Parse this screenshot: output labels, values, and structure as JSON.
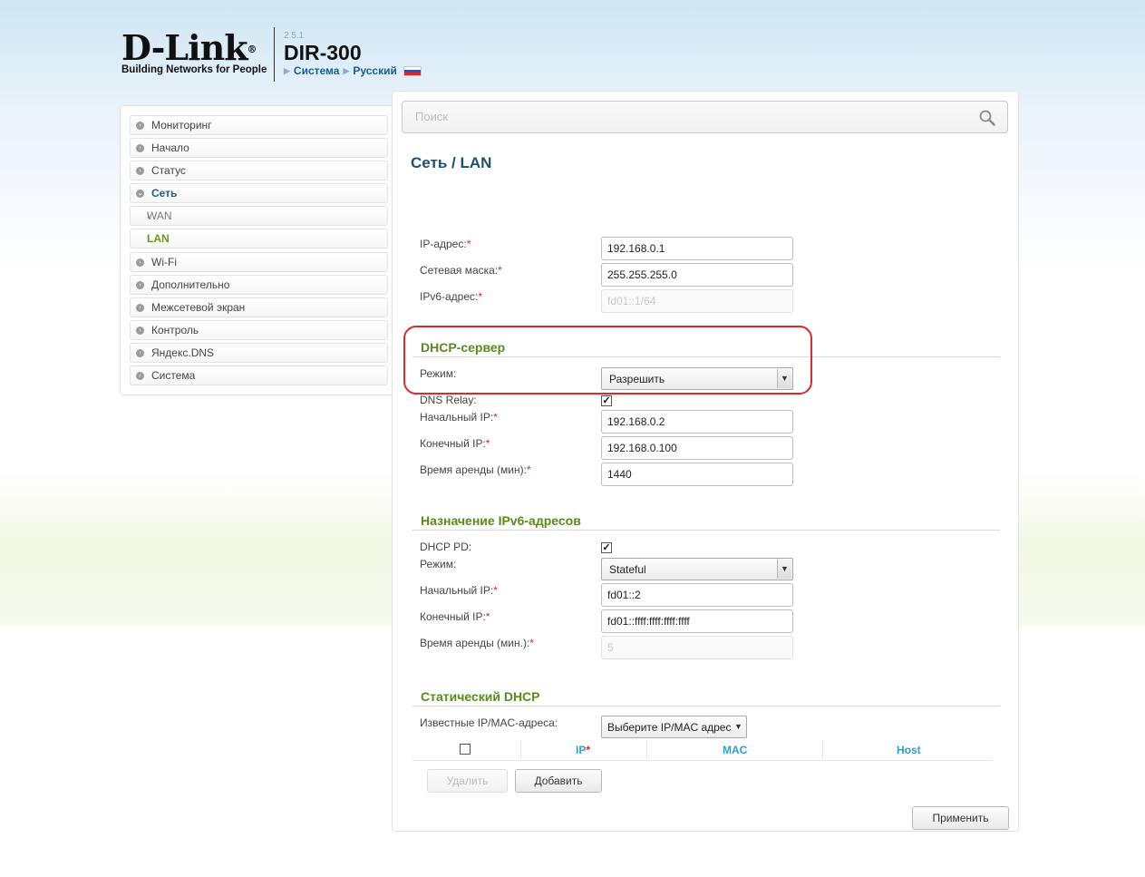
{
  "header": {
    "logo_main": "D-Link",
    "logo_reg": "®",
    "logo_sub": "Building Networks for People",
    "version": "2.5.1",
    "model": "DIR-300",
    "system_link": "Система",
    "language_link": "Русский"
  },
  "sidebar": {
    "items": [
      {
        "label": "Мониторинг"
      },
      {
        "label": "Начало"
      },
      {
        "label": "Статус"
      },
      {
        "label": "Сеть"
      },
      {
        "label": "WAN"
      },
      {
        "label": "LAN"
      },
      {
        "label": "Wi-Fi"
      },
      {
        "label": "Дополнительно"
      },
      {
        "label": "Межсетевой экран"
      },
      {
        "label": "Контроль"
      },
      {
        "label": "Яндекс.DNS"
      },
      {
        "label": "Система"
      }
    ]
  },
  "search": {
    "placeholder": "Поиск"
  },
  "page": {
    "title": "Сеть /  LAN"
  },
  "lan": {
    "ip_label": "IP-адрес:",
    "ip_value": "192.168.0.1",
    "mask_label": "Сетевая маска:",
    "mask_value": "255.255.255.0",
    "ipv6_label": "IPv6-адрес:",
    "ipv6_value": "fd01::1/64"
  },
  "dhcp": {
    "title": "DHCP-сервер",
    "mode_label": "Режим:",
    "mode_value": "Разрешить",
    "relay_label": "DNS Relay:",
    "relay_checked": true,
    "start_label": "Начальный IP:",
    "start_value": "192.168.0.2",
    "end_label": "Конечный IP:",
    "end_value": "192.168.0.100",
    "lease_label": "Время аренды (мин):",
    "lease_value": "1440"
  },
  "ipv6": {
    "title": "Назначение IPv6-адресов",
    "pd_label": "DHCP PD:",
    "pd_checked": true,
    "mode_label": "Режим:",
    "mode_value": "Stateful",
    "start_label": "Начальный IP:",
    "start_value": "fd01::2",
    "end_label": "Конечный IP:",
    "end_value": "fd01::ffff:ffff:ffff:ffff",
    "lease_label": "Время аренды (мин.):",
    "lease_value": "5"
  },
  "static_dhcp": {
    "title": "Статический DHCP",
    "known_label": "Известные IP/MAC-адреса:",
    "known_value": "Выберите IP/MAC адрес",
    "columns": [
      "IP",
      "MAC",
      "Host"
    ],
    "delete_label": "Удалить",
    "add_label": "Добавить"
  },
  "footer": {
    "apply_label": "Применить"
  },
  "required_mark": "*",
  "colors": {
    "accent_title": "#1d4f72",
    "section_green": "#5b8a1b",
    "highlight_red": "#d92b2b",
    "table_header": "#2aa0cc"
  }
}
